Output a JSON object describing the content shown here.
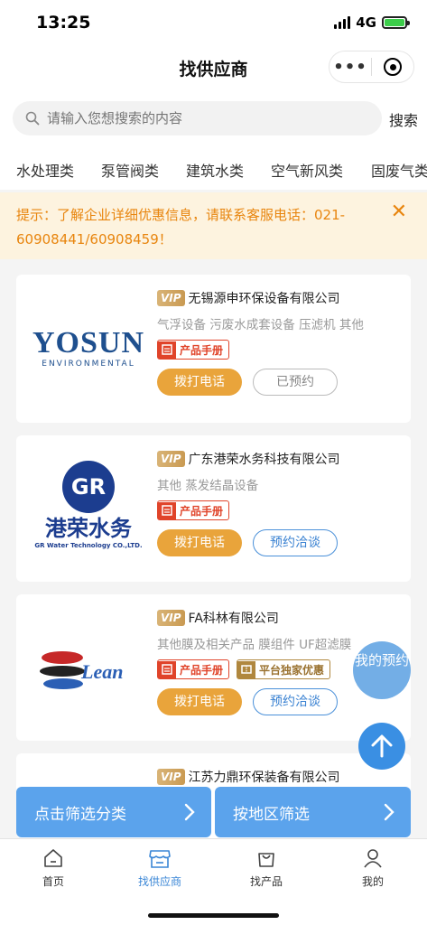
{
  "status": {
    "time": "13:25",
    "network": "4G"
  },
  "nav": {
    "title": "找供应商",
    "more": "•••"
  },
  "search": {
    "placeholder": "请输入您想搜索的内容",
    "button": "搜索"
  },
  "categories": [
    "水处理类",
    "泵管阀类",
    "建筑水类",
    "空气新风类",
    "固废气类"
  ],
  "notice": {
    "text": "提示：了解企业详细优惠信息，请联系客服电话：021-60908441/60908459！"
  },
  "vip_label": "VIP",
  "cards": [
    {
      "company": "无锡源申环保设备有限公司",
      "tags": "气浮设备 污废水成套设备 压滤机 其他",
      "badges": [
        "产品手册"
      ],
      "call": "拨打电话",
      "book": "已预约",
      "logo_text": "YOSUN",
      "logo_sub": "ENVIRONMENTAL"
    },
    {
      "company": "广东港荣水务科技有限公司",
      "tags": "其他 蒸发结晶设备",
      "badges": [
        "产品手册"
      ],
      "call": "拨打电话",
      "book": "预约洽谈",
      "logo_text": "港荣水务",
      "logo_sub": "GR Water Technology CO.,LTD."
    },
    {
      "company": "FA科林有限公司",
      "tags": "其他膜及相关产品 膜组件 UF超滤膜",
      "badges": [
        "产品手册",
        "平台独家优惠"
      ],
      "call": "拨打电话",
      "book": "预约洽谈",
      "logo_text": "Lean"
    },
    {
      "company": "江苏力鼎环保装备有限公司"
    }
  ],
  "floating": {
    "my_booking": "我的预约"
  },
  "filters": {
    "category": "点击筛选分类",
    "region": "按地区筛选"
  },
  "tabbar": [
    {
      "label": "首页",
      "icon": "home-icon"
    },
    {
      "label": "找供应商",
      "icon": "shop-icon"
    },
    {
      "label": "找产品",
      "icon": "bag-icon"
    },
    {
      "label": "我的",
      "icon": "user-icon"
    }
  ],
  "colors": {
    "accent": "#3a86d6",
    "call": "#e9a43b",
    "notice_bg": "#fdf3df",
    "notice_text": "#e8850e",
    "badge_red": "#e0442a"
  }
}
